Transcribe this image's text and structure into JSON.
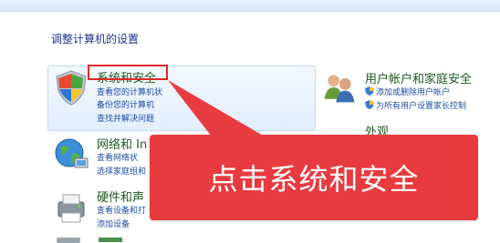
{
  "heading": "调整计算机的设置",
  "categories": [
    {
      "title": "系统和安全",
      "links": [
        "查看您的计算机状",
        "备份您的计算机",
        "查找并解决问题"
      ]
    },
    {
      "title": "网络和 In",
      "links": [
        "查看网络状",
        "选择家庭组和"
      ]
    },
    {
      "title": "硬件和声",
      "links": [
        "查看设备和打",
        "添加设备"
      ]
    },
    {
      "title": "用户帐户和家庭安全",
      "links": [
        "添加或删除用户帐户",
        "为所有用户设置家长控制"
      ]
    },
    {
      "title": "外观",
      "links": []
    }
  ],
  "callout": {
    "text": "点击系统和安全"
  },
  "colors": {
    "callout": "#e83b3f",
    "frame": "#e0262b",
    "title": "#1e5a1e",
    "link": "#1f4fa3"
  }
}
